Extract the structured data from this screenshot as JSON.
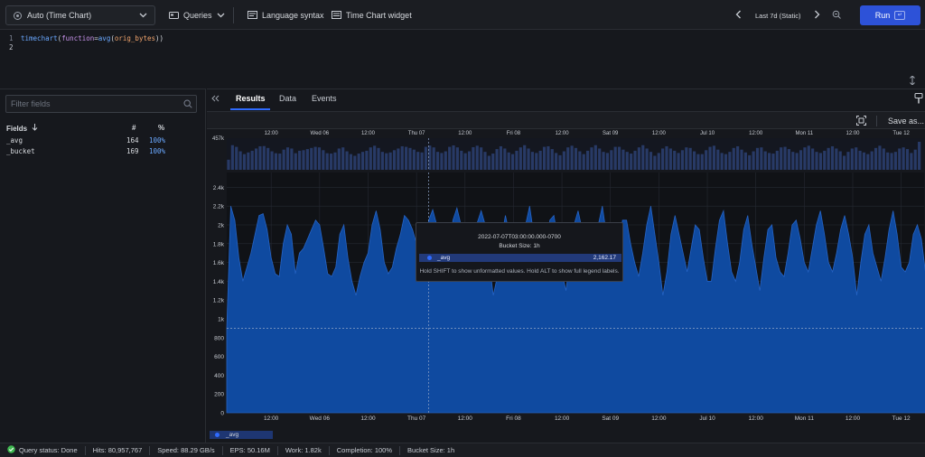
{
  "toolbar": {
    "widget_select": "Auto (Time Chart)",
    "queries": "Queries",
    "language_syntax": "Language syntax",
    "widget_label": "Time Chart widget",
    "time_range": "Last 7d (Static)",
    "run": "Run"
  },
  "editor": {
    "lines": [
      {
        "num": "1",
        "fn": "timechart",
        "open": "(",
        "arg": "function",
        "eq": "=",
        "fn2": "avg",
        "open2": "(",
        "field": "orig_bytes",
        "close": "))"
      },
      {
        "num": "2"
      }
    ]
  },
  "fields_panel": {
    "filter_placeholder": "Filter fields",
    "header_fields": "Fields",
    "header_count": "#",
    "header_pct": "%",
    "rows": [
      {
        "name": "_avg",
        "count": "164",
        "pct": "100%"
      },
      {
        "name": "_bucket",
        "count": "169",
        "pct": "100%"
      }
    ]
  },
  "results": {
    "tabs": [
      "Results",
      "Data",
      "Events"
    ],
    "save_as": "Save as..."
  },
  "tooltip": {
    "timestamp": "2022-07-07T03:00:00.000-0700",
    "bucket": "Bucket Size: 1h",
    "series": "_avg",
    "value": "2,162.17",
    "hint": "Hold SHIFT to show unformatted values. Hold ALT to show full legend labels."
  },
  "status": {
    "query_status": "Query status: Done",
    "hits": "Hits: 80,957,767",
    "speed": "Speed: 88.29 GB/s",
    "eps": "EPS: 50.16M",
    "work": "Work: 1.82k",
    "completion": "Completion: 100%",
    "bucket": "Bucket Size: 1h"
  },
  "colors": {
    "accent": "#2d52d8",
    "series": "#2f6bff",
    "area_fill": "#0f4aa0",
    "status_ok": "#3fb950"
  },
  "chart_data": {
    "type": "area",
    "title": "",
    "xlabel": "",
    "ylabel": "",
    "ylim": [
      0,
      2500
    ],
    "yticks": [
      "0",
      "200",
      "400",
      "600",
      "800",
      "1k",
      "1.2k",
      "1.4k",
      "1.6k",
      "1.8k",
      "2k",
      "2.2k",
      "2.4k"
    ],
    "ytick_values": [
      0,
      200,
      400,
      600,
      800,
      1000,
      1200,
      1400,
      1600,
      1800,
      2000,
      2200,
      2400
    ],
    "xticks": [
      "12:00",
      "Wed 06",
      "12:00",
      "Thu 07",
      "12:00",
      "Fri 08",
      "12:00",
      "Sat 09",
      "12:00",
      "Jul 10",
      "12:00",
      "Mon 11",
      "12:00",
      "Tue 12"
    ],
    "xtick_hours": [
      12,
      24,
      36,
      48,
      60,
      72,
      84,
      96,
      108,
      120,
      132,
      144,
      156,
      168
    ],
    "x_range_hours": [
      1,
      173
    ],
    "overview_label": "457k",
    "legend": [
      "_avg"
    ],
    "crosshair_hour": 51,
    "crosshair_value": 2162.17,
    "guide_value": 900,
    "series": [
      {
        "name": "_avg",
        "values": [
          900,
          2200,
          2050,
          1650,
          1400,
          1550,
          1700,
          1900,
          2100,
          2120,
          1950,
          1650,
          1480,
          1450,
          1800,
          2000,
          1900,
          1480,
          1700,
          1750,
          1850,
          1950,
          2050,
          2000,
          1750,
          1480,
          1450,
          1550,
          1900,
          2000,
          1650,
          1400,
          1250,
          1450,
          1600,
          1700,
          2000,
          2150,
          1950,
          1600,
          1480,
          1550,
          1750,
          1900,
          2100,
          2050,
          1950,
          1800,
          1600,
          1550,
          2050,
          2162,
          2000,
          1600,
          1500,
          1650,
          2050,
          2180,
          2000,
          1700,
          1480,
          1650,
          2020,
          2150,
          2000,
          1600,
          1250,
          1450,
          1850,
          2100,
          1900,
          1550,
          1400,
          1700,
          2000,
          2200,
          1900,
          1600,
          1500,
          1700,
          2050,
          2100,
          1850,
          1500,
          1300,
          1650,
          2000,
          2150,
          1950,
          1650,
          1400,
          1700,
          2000,
          2200,
          1900,
          1600,
          1500,
          1750,
          2050,
          2050,
          1800,
          1600,
          1450,
          1700,
          2000,
          2200,
          1900,
          1600,
          1250,
          1500,
          1900,
          2100,
          1900,
          1700,
          1500,
          1750,
          2000,
          1950,
          1650,
          1400,
          1400,
          1750,
          2050,
          2150,
          1800,
          1500,
          1400,
          1600,
          1950,
          2100,
          1800,
          1550,
          1300,
          1650,
          1950,
          2000,
          1650,
          1500,
          1450,
          1700,
          2000,
          2050,
          1850,
          1600,
          1500,
          1750,
          2000,
          2150,
          1900,
          1600,
          1500,
          1700,
          1950,
          2100,
          1900,
          1650,
          1250,
          1600,
          1900,
          2000,
          1700,
          1550,
          1400,
          1650,
          1950,
          2150,
          1900,
          1550,
          1500,
          1600,
          1900,
          2000,
          1850,
          1500,
          1800,
          2500
        ]
      }
    ]
  }
}
